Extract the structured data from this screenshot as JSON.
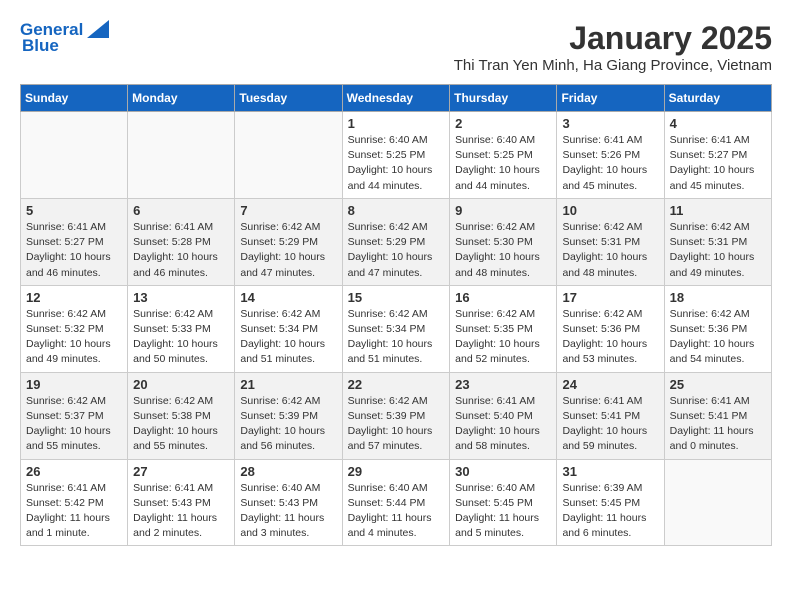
{
  "header": {
    "logo_line1": "General",
    "logo_line2": "Blue",
    "month": "January 2025",
    "location": "Thi Tran Yen Minh, Ha Giang Province, Vietnam"
  },
  "days_of_week": [
    "Sunday",
    "Monday",
    "Tuesday",
    "Wednesday",
    "Thursday",
    "Friday",
    "Saturday"
  ],
  "weeks": [
    [
      {
        "day": "",
        "info": ""
      },
      {
        "day": "",
        "info": ""
      },
      {
        "day": "",
        "info": ""
      },
      {
        "day": "1",
        "info": "Sunrise: 6:40 AM\nSunset: 5:25 PM\nDaylight: 10 hours\nand 44 minutes."
      },
      {
        "day": "2",
        "info": "Sunrise: 6:40 AM\nSunset: 5:25 PM\nDaylight: 10 hours\nand 44 minutes."
      },
      {
        "day": "3",
        "info": "Sunrise: 6:41 AM\nSunset: 5:26 PM\nDaylight: 10 hours\nand 45 minutes."
      },
      {
        "day": "4",
        "info": "Sunrise: 6:41 AM\nSunset: 5:27 PM\nDaylight: 10 hours\nand 45 minutes."
      }
    ],
    [
      {
        "day": "5",
        "info": "Sunrise: 6:41 AM\nSunset: 5:27 PM\nDaylight: 10 hours\nand 46 minutes."
      },
      {
        "day": "6",
        "info": "Sunrise: 6:41 AM\nSunset: 5:28 PM\nDaylight: 10 hours\nand 46 minutes."
      },
      {
        "day": "7",
        "info": "Sunrise: 6:42 AM\nSunset: 5:29 PM\nDaylight: 10 hours\nand 47 minutes."
      },
      {
        "day": "8",
        "info": "Sunrise: 6:42 AM\nSunset: 5:29 PM\nDaylight: 10 hours\nand 47 minutes."
      },
      {
        "day": "9",
        "info": "Sunrise: 6:42 AM\nSunset: 5:30 PM\nDaylight: 10 hours\nand 48 minutes."
      },
      {
        "day": "10",
        "info": "Sunrise: 6:42 AM\nSunset: 5:31 PM\nDaylight: 10 hours\nand 48 minutes."
      },
      {
        "day": "11",
        "info": "Sunrise: 6:42 AM\nSunset: 5:31 PM\nDaylight: 10 hours\nand 49 minutes."
      }
    ],
    [
      {
        "day": "12",
        "info": "Sunrise: 6:42 AM\nSunset: 5:32 PM\nDaylight: 10 hours\nand 49 minutes."
      },
      {
        "day": "13",
        "info": "Sunrise: 6:42 AM\nSunset: 5:33 PM\nDaylight: 10 hours\nand 50 minutes."
      },
      {
        "day": "14",
        "info": "Sunrise: 6:42 AM\nSunset: 5:34 PM\nDaylight: 10 hours\nand 51 minutes."
      },
      {
        "day": "15",
        "info": "Sunrise: 6:42 AM\nSunset: 5:34 PM\nDaylight: 10 hours\nand 51 minutes."
      },
      {
        "day": "16",
        "info": "Sunrise: 6:42 AM\nSunset: 5:35 PM\nDaylight: 10 hours\nand 52 minutes."
      },
      {
        "day": "17",
        "info": "Sunrise: 6:42 AM\nSunset: 5:36 PM\nDaylight: 10 hours\nand 53 minutes."
      },
      {
        "day": "18",
        "info": "Sunrise: 6:42 AM\nSunset: 5:36 PM\nDaylight: 10 hours\nand 54 minutes."
      }
    ],
    [
      {
        "day": "19",
        "info": "Sunrise: 6:42 AM\nSunset: 5:37 PM\nDaylight: 10 hours\nand 55 minutes."
      },
      {
        "day": "20",
        "info": "Sunrise: 6:42 AM\nSunset: 5:38 PM\nDaylight: 10 hours\nand 55 minutes."
      },
      {
        "day": "21",
        "info": "Sunrise: 6:42 AM\nSunset: 5:39 PM\nDaylight: 10 hours\nand 56 minutes."
      },
      {
        "day": "22",
        "info": "Sunrise: 6:42 AM\nSunset: 5:39 PM\nDaylight: 10 hours\nand 57 minutes."
      },
      {
        "day": "23",
        "info": "Sunrise: 6:41 AM\nSunset: 5:40 PM\nDaylight: 10 hours\nand 58 minutes."
      },
      {
        "day": "24",
        "info": "Sunrise: 6:41 AM\nSunset: 5:41 PM\nDaylight: 10 hours\nand 59 minutes."
      },
      {
        "day": "25",
        "info": "Sunrise: 6:41 AM\nSunset: 5:41 PM\nDaylight: 11 hours\nand 0 minutes."
      }
    ],
    [
      {
        "day": "26",
        "info": "Sunrise: 6:41 AM\nSunset: 5:42 PM\nDaylight: 11 hours\nand 1 minute."
      },
      {
        "day": "27",
        "info": "Sunrise: 6:41 AM\nSunset: 5:43 PM\nDaylight: 11 hours\nand 2 minutes."
      },
      {
        "day": "28",
        "info": "Sunrise: 6:40 AM\nSunset: 5:43 PM\nDaylight: 11 hours\nand 3 minutes."
      },
      {
        "day": "29",
        "info": "Sunrise: 6:40 AM\nSunset: 5:44 PM\nDaylight: 11 hours\nand 4 minutes."
      },
      {
        "day": "30",
        "info": "Sunrise: 6:40 AM\nSunset: 5:45 PM\nDaylight: 11 hours\nand 5 minutes."
      },
      {
        "day": "31",
        "info": "Sunrise: 6:39 AM\nSunset: 5:45 PM\nDaylight: 11 hours\nand 6 minutes."
      },
      {
        "day": "",
        "info": ""
      }
    ]
  ]
}
